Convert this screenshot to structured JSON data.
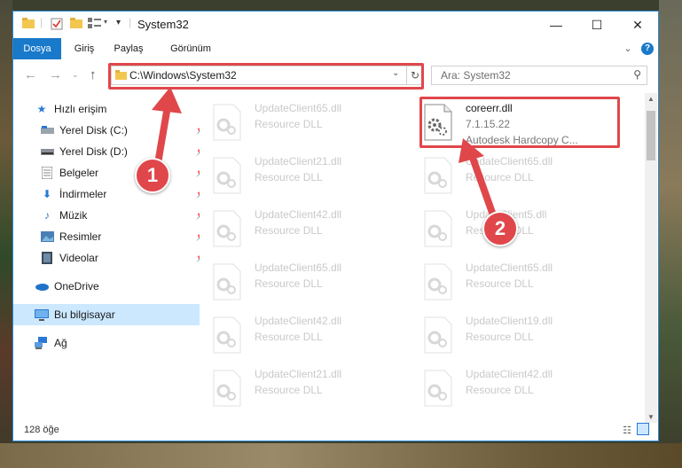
{
  "window": {
    "title": "System32"
  },
  "ribbon": {
    "tabs": [
      {
        "label": "Dosya",
        "active": true
      },
      {
        "label": "Giriş"
      },
      {
        "label": "Paylaş"
      },
      {
        "label": "Görünüm"
      }
    ]
  },
  "address": {
    "path": "C:\\Windows\\System32"
  },
  "search": {
    "placeholder": "Ara: System32"
  },
  "sidebar": {
    "items": [
      {
        "label": "Hızlı erişim",
        "icon": "star-icon"
      },
      {
        "label": "Yerel Disk (C:)",
        "icon": "drive-icon",
        "pinned": true
      },
      {
        "label": "Yerel Disk (D:)",
        "icon": "drive-icon",
        "pinned": true
      },
      {
        "label": "Belgeler",
        "icon": "documents-icon",
        "pinned": true
      },
      {
        "label": "İndirmeler",
        "icon": "download-icon",
        "pinned": true
      },
      {
        "label": "Müzik",
        "icon": "music-icon",
        "pinned": true
      },
      {
        "label": "Resimler",
        "icon": "pictures-icon",
        "pinned": true
      },
      {
        "label": "Videolar",
        "icon": "videos-icon",
        "pinned": true
      },
      {
        "label": "OneDrive",
        "icon": "onedrive-icon"
      },
      {
        "label": "Bu bilgisayar",
        "icon": "computer-icon",
        "selected": true
      },
      {
        "label": "Ağ",
        "icon": "network-icon"
      }
    ]
  },
  "files": {
    "left": [
      {
        "name": "UpdateClient65.dll",
        "type": "Resource DLL"
      },
      {
        "name": "UpdateClient21.dll",
        "type": "Resource DLL"
      },
      {
        "name": "UpdateClient42.dll",
        "type": "Resource DLL"
      },
      {
        "name": "UpdateClient65.dll",
        "type": "Resource DLL"
      },
      {
        "name": "UpdateClient42.dll",
        "type": "Resource DLL"
      },
      {
        "name": "UpdateClient21.dll",
        "type": "Resource DLL"
      }
    ],
    "right_main": {
      "name": "coreerr.dll",
      "version": "7.1.15.22",
      "description": "Autodesk Hardcopy C..."
    },
    "right": [
      {
        "name": "UpdateClient65.dll",
        "type": "Resource DLL"
      },
      {
        "name": "UpdateClient5.dll",
        "type": "Resource DLL"
      },
      {
        "name": "UpdateClient65.dll",
        "type": "Resource DLL"
      },
      {
        "name": "UpdateClient19.dll",
        "type": "Resource DLL"
      },
      {
        "name": "UpdateClient42.dll",
        "type": "Resource DLL"
      }
    ]
  },
  "status": {
    "count": "128 öğe"
  },
  "annotations": {
    "step1": "1",
    "step2": "2",
    "color": "#e0474b"
  }
}
